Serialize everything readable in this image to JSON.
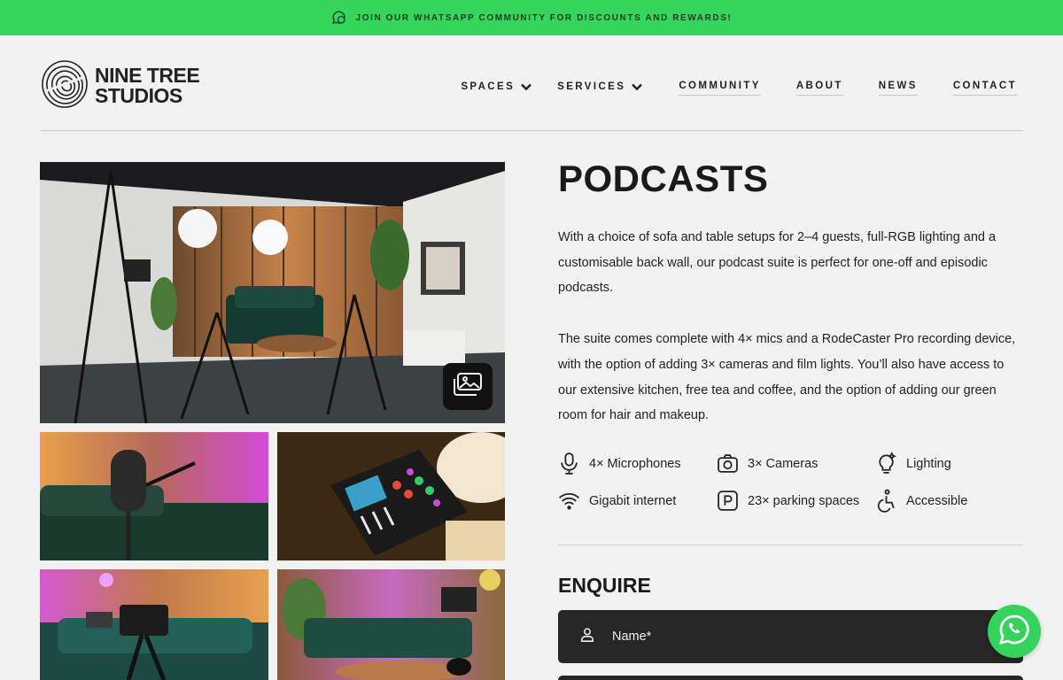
{
  "promo": {
    "text": "JOIN OUR WHATSAPP COMMUNITY FOR DISCOUNTS AND REWARDS!",
    "icon": "whatsapp-icon"
  },
  "logo": {
    "line1": "NINE TREE",
    "line2": "STUDIOS",
    "icon": "fingerprint-logo-icon"
  },
  "nav": {
    "spaces": "SPACES",
    "services": "SERVICES",
    "community": "COMMUNITY",
    "about": "ABOUT",
    "news": "NEWS",
    "contact": "CONTACT"
  },
  "gallery": {
    "button_icon": "gallery-icon",
    "photos": [
      "podcast-studio-room",
      "microphone",
      "rodecaster-mixer",
      "camera-on-tripod",
      "studio-sofa-set"
    ]
  },
  "content": {
    "title": "PODCASTS",
    "para1": "With a choice of sofa and table setups for 2–4 guests, full-RGB lighting and a customisable back wall, our podcast suite is perfect for one-off and episodic podcasts.",
    "para2": "The suite comes complete with 4× mics and a RodeCaster Pro recording device, with the option of adding 3× cameras and film lights. You’ll also have access to our extensive kitchen, free tea and coffee, and the option of adding our green room for hair and makeup."
  },
  "features": [
    {
      "label": "4× Microphones",
      "icon": "microphone-icon"
    },
    {
      "label": "3× Cameras",
      "icon": "camera-icon"
    },
    {
      "label": "Lighting",
      "icon": "lightbulb-icon"
    },
    {
      "label": "Gigabit internet",
      "icon": "wifi-icon"
    },
    {
      "label": "23× parking spaces",
      "icon": "parking-icon"
    },
    {
      "label": "Accessible",
      "icon": "accessible-icon"
    }
  ],
  "enquire": {
    "heading": "ENQUIRE",
    "name_placeholder": "Name*"
  },
  "colors": {
    "promo_bg": "#35d75a",
    "whatsapp": "#36d35c",
    "field_bg": "#262626",
    "page_bg": "#f2f2f2"
  }
}
